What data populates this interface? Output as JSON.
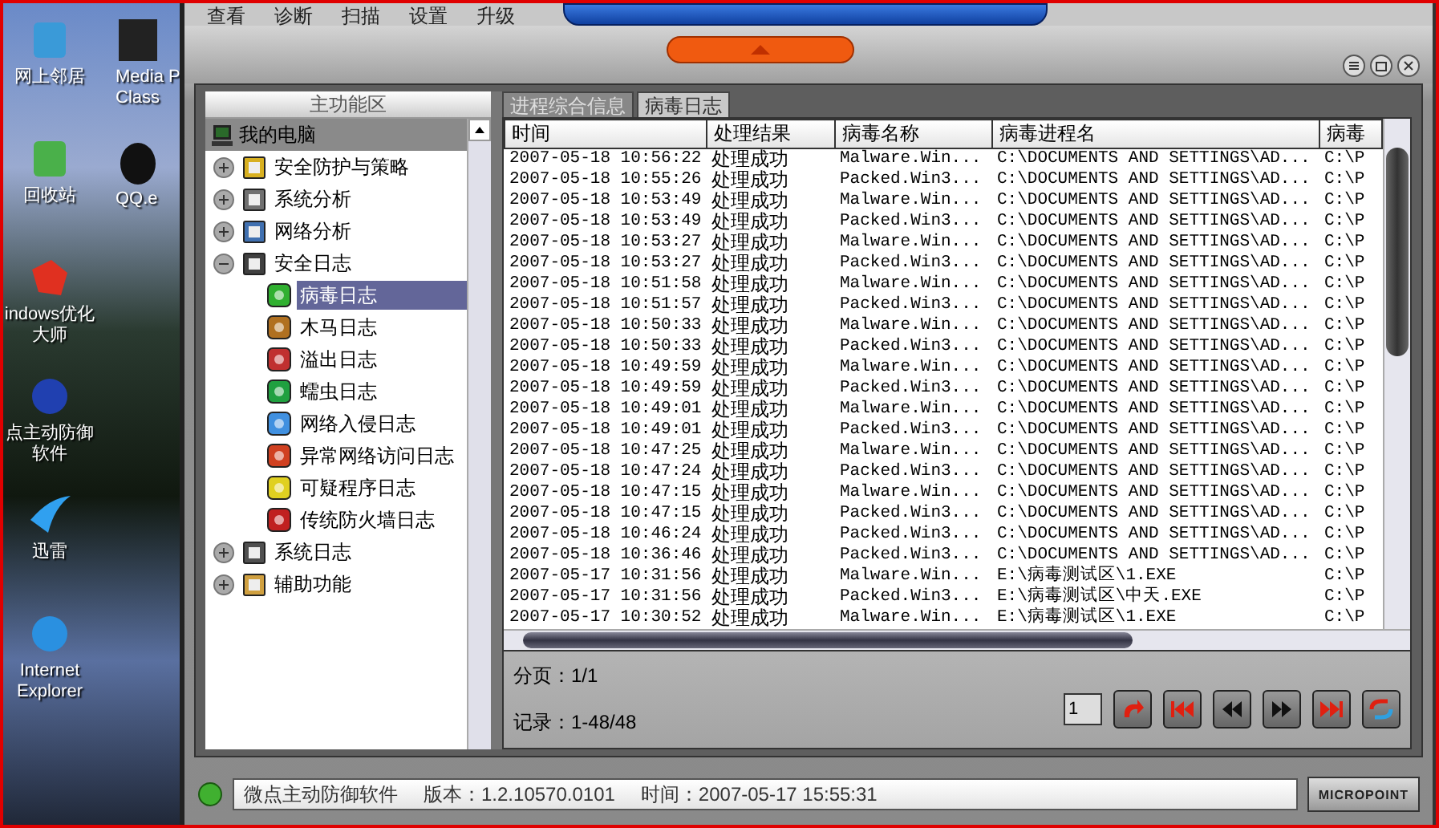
{
  "desktop": {
    "icons": [
      {
        "label": "网上邻居",
        "kind": "network"
      },
      {
        "label": "回收站",
        "kind": "recycle"
      },
      {
        "label": "indows优化大师",
        "kind": "cubes"
      },
      {
        "label": "点主动防御软件",
        "kind": "shield"
      },
      {
        "label": "迅雷",
        "kind": "bird"
      },
      {
        "label": "Internet Explorer",
        "kind": "ie"
      }
    ],
    "icons_right": [
      {
        "label": "Media P Class",
        "kind": "media"
      },
      {
        "label": "QQ.e",
        "kind": "penguin"
      }
    ]
  },
  "menu": [
    "查看",
    "诊断",
    "扫描",
    "设置",
    "升级"
  ],
  "sidebar": {
    "title": "主功能区",
    "root": {
      "label": "我的电脑",
      "kind": "computer",
      "selected": false,
      "children": [
        {
          "label": "安全防护与策略",
          "kind": "barrier",
          "expanded": false,
          "selected": false
        },
        {
          "label": "系统分析",
          "kind": "monitor",
          "expanded": false,
          "selected": false
        },
        {
          "label": "网络分析",
          "kind": "network",
          "expanded": false,
          "selected": false
        },
        {
          "label": "安全日志",
          "kind": "log",
          "expanded": true,
          "selected": false,
          "children": [
            {
              "label": "病毒日志",
              "kind": "virus",
              "selected": true
            },
            {
              "label": "木马日志",
              "kind": "horse",
              "selected": false
            },
            {
              "label": "溢出日志",
              "kind": "overflow",
              "selected": false
            },
            {
              "label": "蠕虫日志",
              "kind": "worm",
              "selected": false
            },
            {
              "label": "网络入侵日志",
              "kind": "sword",
              "selected": false
            },
            {
              "label": "异常网络访问日志",
              "kind": "netdoc",
              "selected": false
            },
            {
              "label": "可疑程序日志",
              "kind": "query",
              "selected": false
            },
            {
              "label": "传统防火墙日志",
              "kind": "firewall",
              "selected": false
            }
          ]
        },
        {
          "label": "系统日志",
          "kind": "syslog",
          "expanded": false,
          "selected": false
        },
        {
          "label": "辅助功能",
          "kind": "helper",
          "expanded": false,
          "selected": false
        }
      ]
    }
  },
  "tabs": [
    {
      "label": "进程综合信息",
      "selected": false
    },
    {
      "label": "病毒日志",
      "selected": true
    }
  ],
  "table": {
    "columns": [
      "时间",
      "处理结果",
      "病毒名称",
      "病毒进程名",
      "病毒"
    ],
    "rows": [
      [
        "2007-05-18 10:56:22",
        "处理成功",
        "Malware.Win...",
        "C:\\DOCUMENTS AND SETTINGS\\AD...",
        "C:\\P"
      ],
      [
        "2007-05-18 10:55:26",
        "处理成功",
        "Packed.Win3...",
        "C:\\DOCUMENTS AND SETTINGS\\AD...",
        "C:\\P"
      ],
      [
        "2007-05-18 10:53:49",
        "处理成功",
        "Malware.Win...",
        "C:\\DOCUMENTS AND SETTINGS\\AD...",
        "C:\\P"
      ],
      [
        "2007-05-18 10:53:49",
        "处理成功",
        "Packed.Win3...",
        "C:\\DOCUMENTS AND SETTINGS\\AD...",
        "C:\\P"
      ],
      [
        "2007-05-18 10:53:27",
        "处理成功",
        "Malware.Win...",
        "C:\\DOCUMENTS AND SETTINGS\\AD...",
        "C:\\P"
      ],
      [
        "2007-05-18 10:53:27",
        "处理成功",
        "Packed.Win3...",
        "C:\\DOCUMENTS AND SETTINGS\\AD...",
        "C:\\P"
      ],
      [
        "2007-05-18 10:51:58",
        "处理成功",
        "Malware.Win...",
        "C:\\DOCUMENTS AND SETTINGS\\AD...",
        "C:\\P"
      ],
      [
        "2007-05-18 10:51:57",
        "处理成功",
        "Packed.Win3...",
        "C:\\DOCUMENTS AND SETTINGS\\AD...",
        "C:\\P"
      ],
      [
        "2007-05-18 10:50:33",
        "处理成功",
        "Malware.Win...",
        "C:\\DOCUMENTS AND SETTINGS\\AD...",
        "C:\\P"
      ],
      [
        "2007-05-18 10:50:33",
        "处理成功",
        "Packed.Win3...",
        "C:\\DOCUMENTS AND SETTINGS\\AD...",
        "C:\\P"
      ],
      [
        "2007-05-18 10:49:59",
        "处理成功",
        "Malware.Win...",
        "C:\\DOCUMENTS AND SETTINGS\\AD...",
        "C:\\P"
      ],
      [
        "2007-05-18 10:49:59",
        "处理成功",
        "Packed.Win3...",
        "C:\\DOCUMENTS AND SETTINGS\\AD...",
        "C:\\P"
      ],
      [
        "2007-05-18 10:49:01",
        "处理成功",
        "Malware.Win...",
        "C:\\DOCUMENTS AND SETTINGS\\AD...",
        "C:\\P"
      ],
      [
        "2007-05-18 10:49:01",
        "处理成功",
        "Packed.Win3...",
        "C:\\DOCUMENTS AND SETTINGS\\AD...",
        "C:\\P"
      ],
      [
        "2007-05-18 10:47:25",
        "处理成功",
        "Malware.Win...",
        "C:\\DOCUMENTS AND SETTINGS\\AD...",
        "C:\\P"
      ],
      [
        "2007-05-18 10:47:24",
        "处理成功",
        "Packed.Win3...",
        "C:\\DOCUMENTS AND SETTINGS\\AD...",
        "C:\\P"
      ],
      [
        "2007-05-18 10:47:15",
        "处理成功",
        "Malware.Win...",
        "C:\\DOCUMENTS AND SETTINGS\\AD...",
        "C:\\P"
      ],
      [
        "2007-05-18 10:47:15",
        "处理成功",
        "Packed.Win3...",
        "C:\\DOCUMENTS AND SETTINGS\\AD...",
        "C:\\P"
      ],
      [
        "2007-05-18 10:46:24",
        "处理成功",
        "Packed.Win3...",
        "C:\\DOCUMENTS AND SETTINGS\\AD...",
        "C:\\P"
      ],
      [
        "2007-05-18 10:36:46",
        "处理成功",
        "Packed.Win3...",
        "C:\\DOCUMENTS AND SETTINGS\\AD...",
        "C:\\P"
      ],
      [
        "2007-05-17 10:31:56",
        "处理成功",
        "Malware.Win...",
        "E:\\病毒测试区\\1.EXE",
        "C:\\P"
      ],
      [
        "2007-05-17 10:31:56",
        "处理成功",
        "Packed.Win3...",
        "E:\\病毒测试区\\中天.EXE",
        "C:\\P"
      ],
      [
        "2007-05-17 10:30:52",
        "处理成功",
        "Malware.Win...",
        "E:\\病毒测试区\\1.EXE",
        "C:\\P"
      ]
    ]
  },
  "pager": {
    "page": "分页：1/1",
    "records": "记录：1-48/48",
    "page_input": "1"
  },
  "status_bar": {
    "app": "微点主动防御软件",
    "version": "版本：1.2.10570.0101",
    "time": "时间：2007-05-17 15:55:31",
    "logo": "MICROPOINT"
  }
}
